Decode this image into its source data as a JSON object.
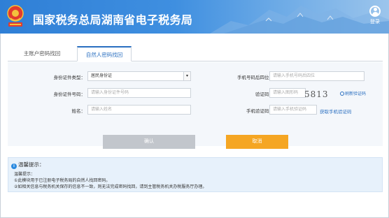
{
  "header": {
    "title": "国家税务总局湖南省电子税务局",
    "login_label": "登录"
  },
  "tabs": [
    {
      "label": "主账户密码找回",
      "active": false
    },
    {
      "label": "自然人密码找回",
      "active": true
    }
  ],
  "form": {
    "id_type": {
      "label": "身份证件类型：",
      "value": "居民身份证"
    },
    "id_number": {
      "label": "身份证件号码：",
      "placeholder": "请输入身份证件号码"
    },
    "name": {
      "label": "姓名：",
      "placeholder": "请输入姓名"
    },
    "phone_last4": {
      "label": "手机号码后四位：",
      "placeholder": "请输入手机号码后四位"
    },
    "captcha": {
      "label": "验证码：",
      "placeholder": "请输入图形码",
      "image_text": "5813",
      "refresh_label": "刷新验证码"
    },
    "sms_code": {
      "label": "手机验证码：",
      "placeholder": "请输入手机验证码",
      "get_code_label": "获取手机验证码"
    }
  },
  "buttons": {
    "confirm": "确认",
    "cancel": "取消"
  },
  "tips": {
    "title": "温馨提示：",
    "subtitle": "温馨提示：",
    "line1": "①此模块用于已注册电子税务局的自然人找回密码。",
    "line2": "②如相关信息与税务机关保存的信息不一致，则无法完成密码找回，请到主管税务机关办税服务厅办理。"
  },
  "colors": {
    "header_blue": "#3a8ae0",
    "tab_active": "#2a6fc0",
    "confirm_disabled": "#c2c6cc",
    "cancel_orange": "#f5a623",
    "tips_bg": "#e7f1fb"
  },
  "icons": [
    "tax-emblem-icon",
    "user-icon",
    "select-arrow-icon",
    "refresh-icon",
    "info-icon"
  ]
}
